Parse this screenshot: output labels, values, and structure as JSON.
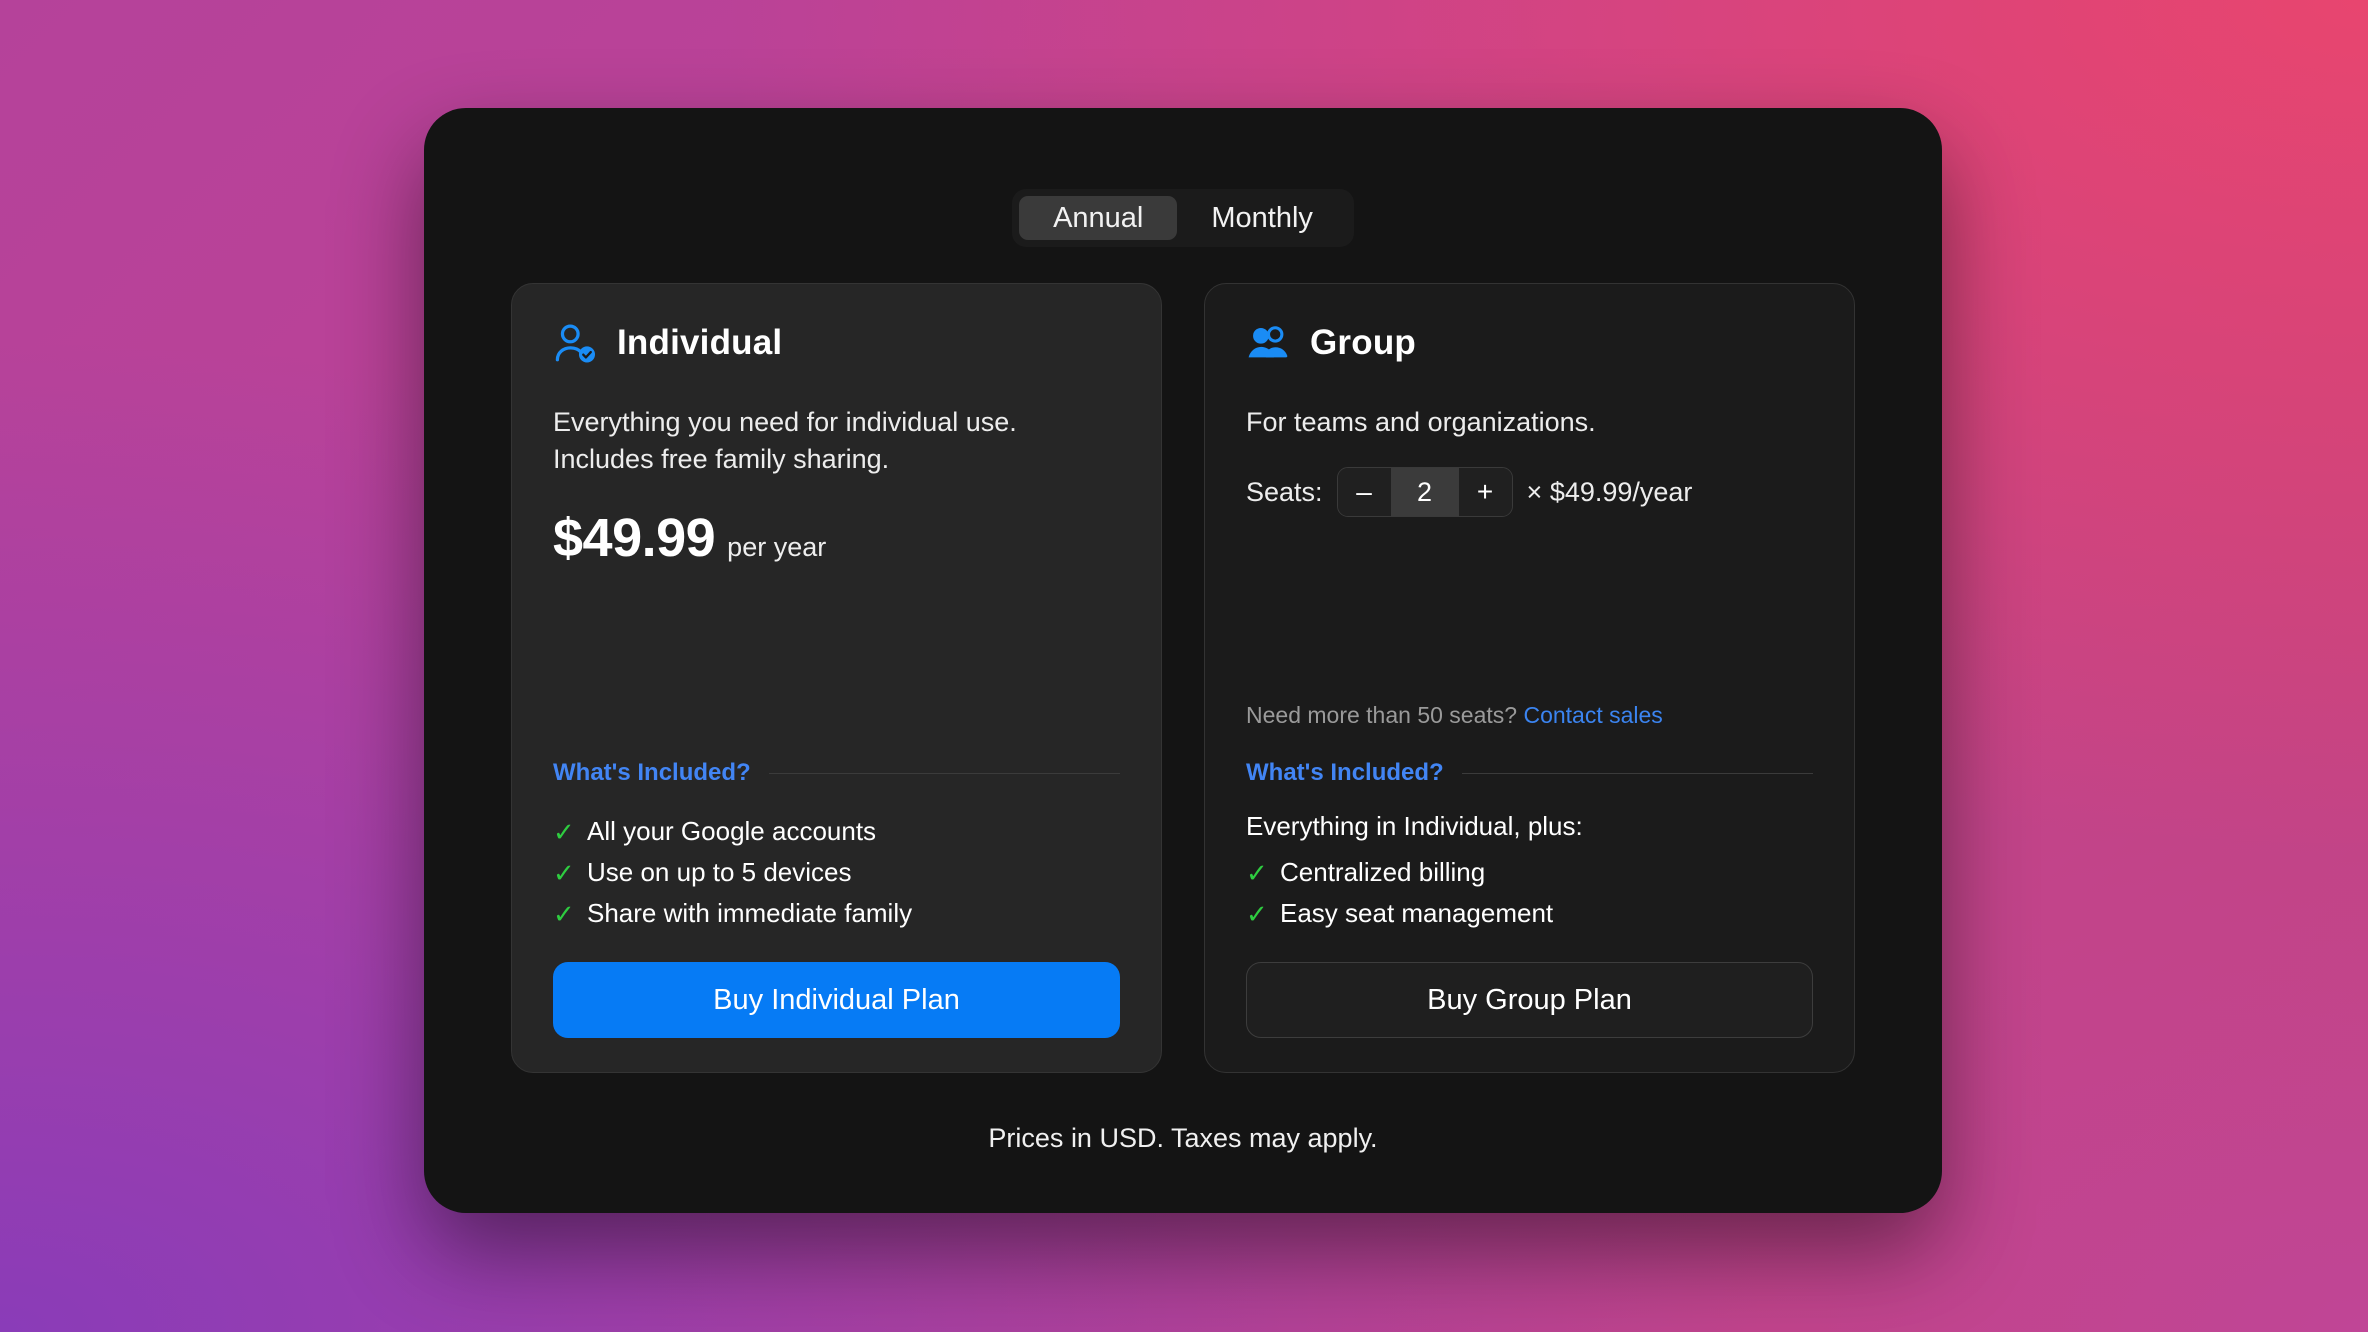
{
  "billing_toggle": {
    "options": [
      {
        "label": "Annual",
        "selected": true
      },
      {
        "label": "Monthly",
        "selected": false
      }
    ]
  },
  "plans": {
    "individual": {
      "icon": "person-check-icon",
      "title": "Individual",
      "description": "Everything you need for individual use. Includes free family sharing.",
      "price_amount": "$49.99",
      "price_period": "per year",
      "included_title": "What's Included?",
      "features": [
        "All your Google accounts",
        "Use on up to 5 devices",
        "Share with immediate family"
      ],
      "cta_label": "Buy Individual Plan"
    },
    "group": {
      "icon": "people-icon",
      "title": "Group",
      "description": "For teams and organizations.",
      "seats_label": "Seats:",
      "seats_value": "2",
      "decrement_label": "–",
      "increment_label": "+",
      "seats_unit": "× $49.99/year",
      "contact_prompt": "Need more than 50 seats?",
      "contact_link": "Contact sales",
      "included_title": "What's Included?",
      "features_lead": "Everything in Individual, plus:",
      "features": [
        "Centralized billing",
        "Easy seat management"
      ],
      "cta_label": "Buy Group Plan"
    }
  },
  "footer": {
    "note": "Prices in USD. Taxes may apply."
  },
  "colors": {
    "accent_blue": "#067bf5",
    "link_blue": "#4285f4",
    "check_green": "#2ecc40",
    "card_light": "#262626",
    "card_dark": "#1b1b1b",
    "window_bg": "#141414"
  },
  "icons": {
    "check_glyph": "✓",
    "multiply_glyph": "×"
  }
}
